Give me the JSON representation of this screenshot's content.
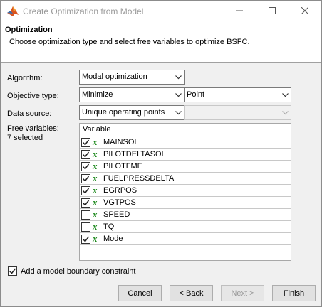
{
  "window": {
    "title": "Create Optimization from Model",
    "controls": [
      "minimize-icon",
      "maximize-icon",
      "close-icon"
    ]
  },
  "header": {
    "title": "Optimization",
    "subtitle": "Choose optimization type and select free variables to optimize BSFC."
  },
  "form": {
    "algorithm_label": "Algorithm:",
    "algorithm_value": "Modal optimization",
    "objective_label": "Objective type:",
    "objective_value": "Minimize",
    "objective_mode_value": "Point",
    "datasource_label": "Data source:",
    "datasource_value": "Unique operating points",
    "datasource_secondary_value": "",
    "free_vars_label": "Free variables:",
    "free_vars_count": "7 selected"
  },
  "variables": {
    "header": "Variable",
    "items": [
      {
        "name": "MAINSOI",
        "checked": true,
        "icon": "x-variable-icon"
      },
      {
        "name": "PILOTDELTASOI",
        "checked": true,
        "icon": "x-variable-icon"
      },
      {
        "name": "PILOTFMF",
        "checked": true,
        "icon": "x-variable-icon"
      },
      {
        "name": "FUELPRESSDELTA",
        "checked": true,
        "icon": "x-variable-icon"
      },
      {
        "name": "EGRPOS",
        "checked": true,
        "icon": "x-variable-icon"
      },
      {
        "name": "VGTPOS",
        "checked": true,
        "icon": "x-variable-icon"
      },
      {
        "name": "SPEED",
        "checked": false,
        "icon": "x-variable-icon"
      },
      {
        "name": "TQ",
        "checked": false,
        "icon": "x-variable-icon"
      },
      {
        "name": "Mode",
        "checked": true,
        "icon": "x-variable-icon"
      }
    ]
  },
  "boundary": {
    "label": "Add a model boundary constraint",
    "checked": true
  },
  "buttons": {
    "cancel": "Cancel",
    "back": "< Back",
    "next": "Next >",
    "finish": "Finish"
  }
}
